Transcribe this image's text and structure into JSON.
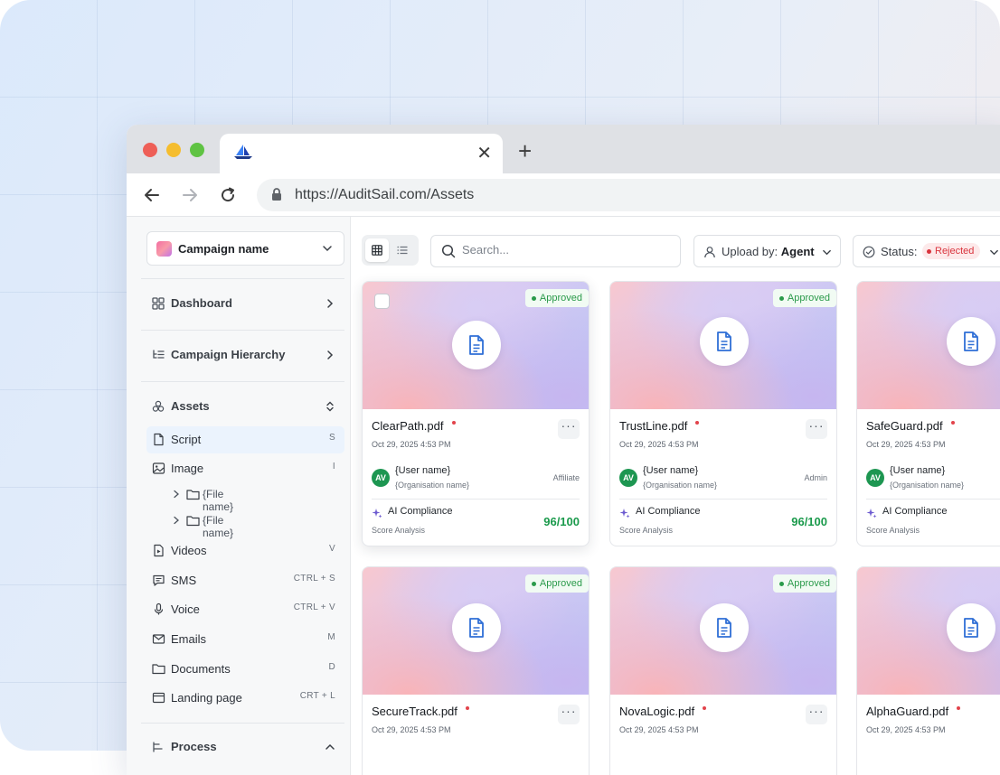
{
  "browser": {
    "url": "https://AuditSail.com/Assets",
    "tab_close": "✕",
    "new_tab": "+"
  },
  "sidebar": {
    "campaign": "Campaign name",
    "sections": {
      "dashboard": "Dashboard",
      "hierarchy": "Campaign Hierarchy",
      "assets": "Assets",
      "process": "Process"
    },
    "items": [
      {
        "label": "Script",
        "shortcut": "S"
      },
      {
        "label": "Image",
        "shortcut": "I"
      },
      {
        "label": "Videos",
        "shortcut": "V"
      },
      {
        "label": "SMS",
        "shortcut": "CTRL + S"
      },
      {
        "label": "Voice",
        "shortcut": "CTRL + V"
      },
      {
        "label": "Emails",
        "shortcut": "M"
      },
      {
        "label": "Documents",
        "shortcut": "D"
      },
      {
        "label": "Landing page",
        "shortcut": "CRT + L"
      }
    ],
    "image_children": [
      "{File name}",
      "{File name}"
    ]
  },
  "toolbar": {
    "search_placeholder": "Search...",
    "upload_label": "Upload by:",
    "upload_value": "Agent",
    "status_label": "Status:",
    "status_value": "Rejected"
  },
  "cards": [
    {
      "name": "ClearPath.pdf",
      "date": "Oct 29, 2025 4:53 PM",
      "status": "Approved",
      "avatar": "AV",
      "user": "{User name}",
      "org": "{Organisation name}",
      "role": "Affiliate",
      "ai_title": "AI Compliance",
      "ai_sub": "Score Analysis",
      "score": "96/100"
    },
    {
      "name": "TrustLine.pdf",
      "date": "Oct 29, 2025 4:53 PM",
      "status": "Approved",
      "avatar": "AV",
      "user": "{User name}",
      "org": "{Organisation name}",
      "role": "Admin",
      "ai_title": "AI Compliance",
      "ai_sub": "Score Analysis",
      "score": "96/100"
    },
    {
      "name": "SafeGuard.pdf",
      "date": "Oct 29, 2025 4:53 PM",
      "status": "",
      "avatar": "AV",
      "user": "{User name}",
      "org": "{Organisation name}",
      "role": "",
      "ai_title": "AI Compliance",
      "ai_sub": "Score Analysis",
      "score": ""
    },
    {
      "name": "SecureTrack.pdf",
      "date": "Oct 29, 2025 4:53 PM",
      "status": "Approved"
    },
    {
      "name": "NovaLogic.pdf",
      "date": "Oct 29, 2025 4:53 PM",
      "status": "Approved"
    },
    {
      "name": "AlphaGuard.pdf",
      "date": "Oct 29, 2025 4:53 PM",
      "status": ""
    }
  ],
  "card_more": "···",
  "colors": {
    "accent": "#2f6fd6",
    "approved": "#2a9a4a",
    "rejected": "#d9343d",
    "score": "#1b9a4c",
    "avatar": "#1d9651"
  }
}
